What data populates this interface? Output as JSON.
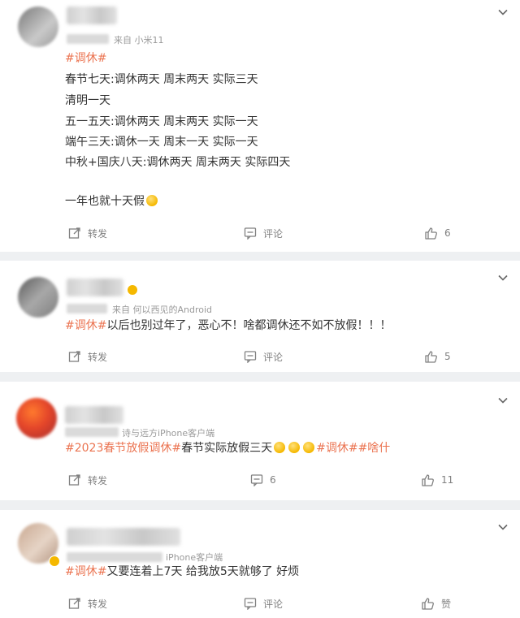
{
  "comments": [
    {
      "source": "来自 小米11",
      "lines": [
        {
          "tag": "#调休#",
          "text": ""
        },
        {
          "tag": "",
          "text": "春节七天:调休两天 周末两天 实际三天"
        },
        {
          "tag": "",
          "text": "清明一天"
        },
        {
          "tag": "",
          "text": "五一五天:调休两天 周末两天 实际一天"
        },
        {
          "tag": "",
          "text": "端午三天:调休一天 周末一天 实际一天"
        },
        {
          "tag": "",
          "text": "中秋+国庆八天:调休两天 周末两天 实际四天"
        },
        {
          "tag": "",
          "text": "一年也就十天假"
        }
      ],
      "repost_label": "转发",
      "comment_label": "评论",
      "like_count": "6"
    },
    {
      "source": "来自 何以西见的Android",
      "tag": "#调休#",
      "text": "以后也别过年了，恶心不！啥都调休还不如不放假！！！",
      "repost_label": "转发",
      "comment_label": "评论",
      "like_count": "5"
    },
    {
      "source": "诗与远方iPhone客户端",
      "tag1": "#2023春节放假调休#",
      "text": "春节实际放假三天",
      "tag2": "#调休#",
      "tag3": "#啥什",
      "repost_label": "转发",
      "comment_count": "6",
      "like_count": "11"
    },
    {
      "source": "iPhone客户端",
      "tag": "#调休#",
      "text": "又要连着上7天 给我放5天就够了 好烦",
      "repost_label": "转发",
      "comment_label": "评论",
      "like_label": "赞"
    }
  ],
  "icons": {
    "repost": "repost-icon",
    "comment": "comment-icon",
    "like": "thumbs-up-icon",
    "more": "chevron-down-icon"
  },
  "colors": {
    "tag": "#eb7350",
    "meta": "#9a9a9a",
    "action": "#808080"
  }
}
